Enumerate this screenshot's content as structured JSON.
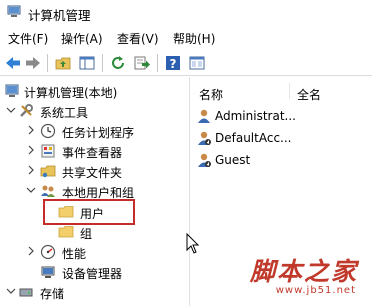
{
  "window": {
    "title": "计算机管理"
  },
  "menu": [
    {
      "label": "文件(F)"
    },
    {
      "label": "操作(A)"
    },
    {
      "label": "查看(V)"
    },
    {
      "label": "帮助(H)"
    }
  ],
  "toolbar": {
    "buttons": [
      "back-arrow-icon",
      "forward-arrow-icon",
      "up-folder-icon",
      "show-hide-tree-icon",
      "refresh-icon",
      "export-list-icon",
      "help-icon",
      "properties-icon"
    ]
  },
  "tree": {
    "root": "计算机管理(本地)",
    "system_tools": "系统工具",
    "task_scheduler": "任务计划程序",
    "event_viewer": "事件查看器",
    "shared_folders": "共享文件夹",
    "local_users_groups": "本地用户和组",
    "users": "用户",
    "groups": "组",
    "performance": "性能",
    "device_manager": "设备管理器",
    "storage": "存储"
  },
  "list": {
    "columns": [
      "名称",
      "全名"
    ],
    "rows": [
      {
        "name": "Administrat..."
      },
      {
        "name": "DefaultAcc..."
      },
      {
        "name": "Guest"
      }
    ]
  },
  "watermark": {
    "big": "脚本之家",
    "small": "www.jb51.net"
  },
  "colors": {
    "highlight_border": "#c42b2b",
    "watermark": "#c0392b"
  }
}
